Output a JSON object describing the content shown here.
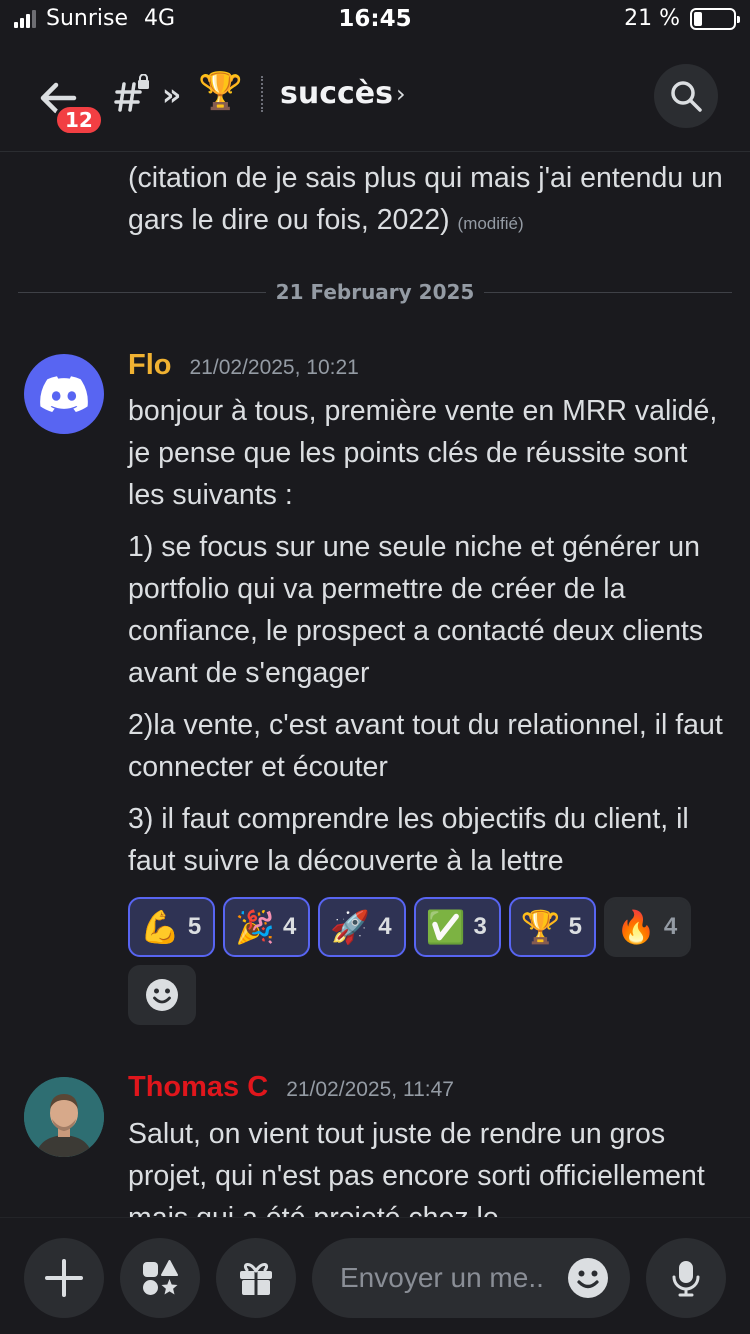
{
  "status": {
    "carrier": "Sunrise",
    "network": "4G",
    "time": "16:45",
    "battery": "21 %",
    "battery_level": 0.21
  },
  "header": {
    "unread_count": "12",
    "double_chevron": "»",
    "trophy_emoji": "🏆",
    "channel_name": "succès",
    "chevron": "›"
  },
  "messages": {
    "previous": {
      "text": "(citation de je sais plus qui mais j'ai entendu un gars le dire ou fois, 2022)",
      "edited": "(modifié)"
    },
    "date_divider": "21 February 2025",
    "flo": {
      "author": "Flo",
      "author_color": "#f0b232",
      "timestamp": "21/02/2025, 10:21",
      "paragraphs": [
        "bonjour à tous, première vente en MRR validé, je pense que les points clés de réussite sont les suivants :",
        "1) se focus sur une seule niche et générer un portfolio qui va permettre de créer de la confiance, le prospect a contacté deux clients avant de s'engager",
        "2)la vente, c'est avant tout du relationnel, il faut connecter et écouter",
        "3) il faut comprendre les objectifs du client, il faut suivre la découverte à la lettre"
      ],
      "reactions": [
        {
          "emoji": "💪",
          "count": "5",
          "reacted": true
        },
        {
          "emoji": "🎉",
          "count": "4",
          "reacted": true
        },
        {
          "emoji": "🚀",
          "count": "4",
          "reacted": true
        },
        {
          "emoji": "✅",
          "count": "3",
          "reacted": true
        },
        {
          "emoji": "🏆",
          "count": "5",
          "reacted": true
        },
        {
          "emoji": "🔥",
          "count": "4",
          "reacted": false
        }
      ]
    },
    "thomas": {
      "author": "Thomas C",
      "author_color": "#e0161c",
      "timestamp": "21/02/2025, 11:47",
      "text": "Salut, on vient tout juste de rendre un gros projet, qui n'est pas encore sorti officiellement mais qui a été projeté chez le"
    }
  },
  "composer": {
    "placeholder": "Envoyer un me.."
  },
  "colors": {
    "background": "#1a1a1e",
    "blurple": "#5865f2",
    "badge_red": "#f23f43"
  },
  "icons": [
    "back-arrow-icon",
    "locked-hash-icon",
    "search-icon",
    "discord-logo-icon",
    "arrow-down-icon",
    "plus-icon",
    "apps-icon",
    "gift-icon",
    "emoji-icon",
    "microphone-icon"
  ]
}
